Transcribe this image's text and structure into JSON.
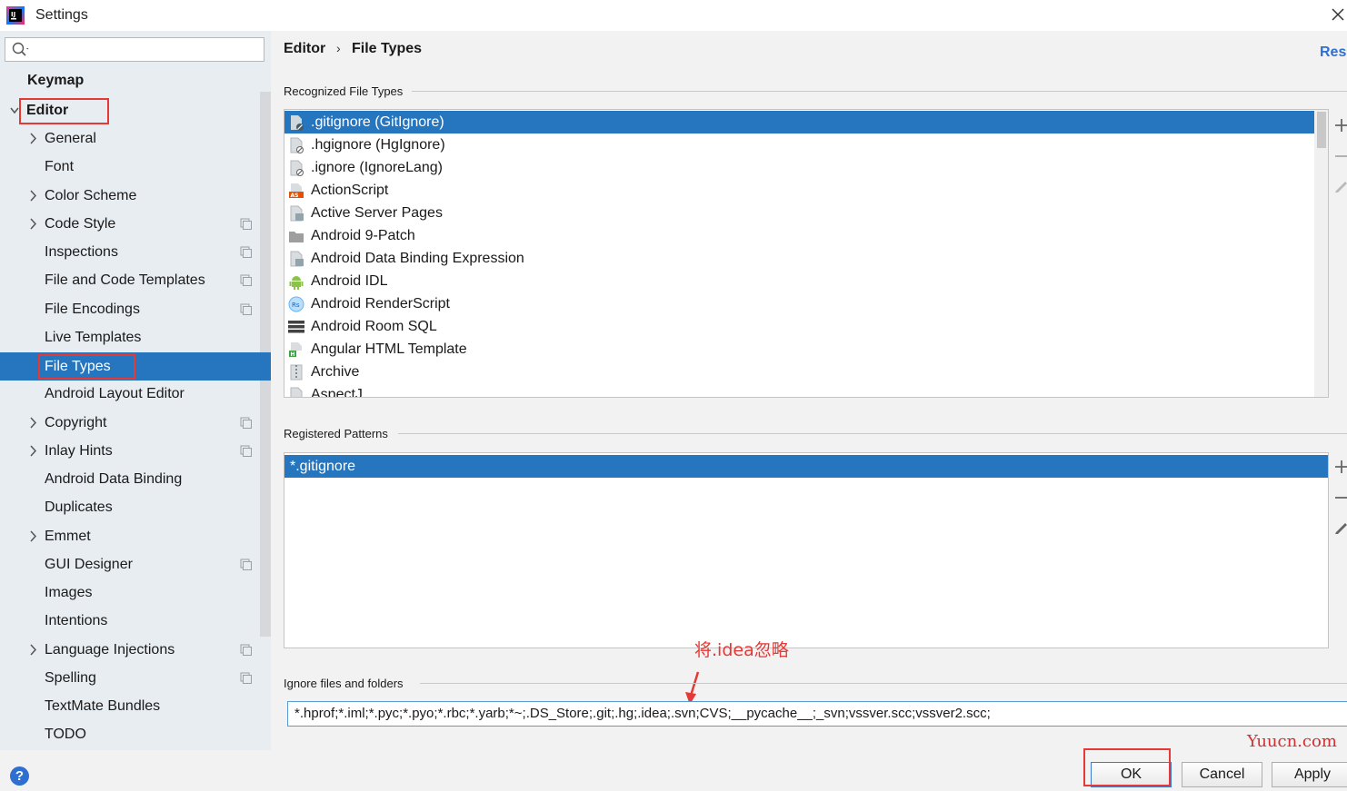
{
  "window": {
    "title": "Settings"
  },
  "search": {
    "placeholder": ""
  },
  "sidebar": {
    "items": [
      {
        "label": "Keymap",
        "name": "keymap"
      },
      {
        "label": "Editor",
        "name": "editor"
      },
      {
        "label": "General",
        "name": "general"
      },
      {
        "label": "Font",
        "name": "font"
      },
      {
        "label": "Color Scheme",
        "name": "color-scheme"
      },
      {
        "label": "Code Style",
        "name": "code-style"
      },
      {
        "label": "Inspections",
        "name": "inspections"
      },
      {
        "label": "File and Code Templates",
        "name": "file-and-code-templates"
      },
      {
        "label": "File Encodings",
        "name": "file-encodings"
      },
      {
        "label": "Live Templates",
        "name": "live-templates"
      },
      {
        "label": "File Types",
        "name": "file-types"
      },
      {
        "label": "Android Layout Editor",
        "name": "android-layout-editor"
      },
      {
        "label": "Copyright",
        "name": "copyright"
      },
      {
        "label": "Inlay Hints",
        "name": "inlay-hints"
      },
      {
        "label": "Android Data Binding",
        "name": "android-data-binding"
      },
      {
        "label": "Duplicates",
        "name": "duplicates"
      },
      {
        "label": "Emmet",
        "name": "emmet"
      },
      {
        "label": "GUI Designer",
        "name": "gui-designer"
      },
      {
        "label": "Images",
        "name": "images"
      },
      {
        "label": "Intentions",
        "name": "intentions"
      },
      {
        "label": "Language Injections",
        "name": "language-injections"
      },
      {
        "label": "Spelling",
        "name": "spelling"
      },
      {
        "label": "TextMate Bundles",
        "name": "textmate-bundles"
      },
      {
        "label": "TODO",
        "name": "todo"
      }
    ]
  },
  "header": {
    "breadcrumb_parent": "Editor",
    "breadcrumb_sep": "›",
    "breadcrumb_current": "File Types",
    "reset_label": "Rese"
  },
  "recognized": {
    "title": "Recognized File Types",
    "items": [
      {
        "label": ".gitignore (GitIgnore)",
        "icon": "gitignore-file-icon"
      },
      {
        "label": ".hgignore (HgIgnore)",
        "icon": "ignore-file-icon"
      },
      {
        "label": ".ignore (IgnoreLang)",
        "icon": "ignore-file-icon"
      },
      {
        "label": "ActionScript",
        "icon": "actionscript-icon"
      },
      {
        "label": "Active Server Pages",
        "icon": "asp-file-icon"
      },
      {
        "label": "Android 9-Patch",
        "icon": "folder-icon"
      },
      {
        "label": "Android Data Binding Expression",
        "icon": "binding-file-icon"
      },
      {
        "label": "Android IDL",
        "icon": "android-icon"
      },
      {
        "label": "Android RenderScript",
        "icon": "renderscript-icon"
      },
      {
        "label": "Android Room SQL",
        "icon": "sql-icon"
      },
      {
        "label": "Angular HTML Template",
        "icon": "html-file-icon"
      },
      {
        "label": "Archive",
        "icon": "archive-icon"
      },
      {
        "label": "AspectJ",
        "icon": "aspectj-icon"
      }
    ]
  },
  "patterns": {
    "title": "Registered Patterns",
    "items": [
      {
        "label": "*.gitignore"
      }
    ]
  },
  "ignore": {
    "title": "Ignore files and folders",
    "value": "*.hprof;*.iml;*.pyc;*.pyo;*.rbc;*.yarb;*~;.DS_Store;.git;.hg;.idea;.svn;CVS;__pycache__;_svn;vssver.scc;vssver2.scc;"
  },
  "annotation": {
    "text": "将.idea忽略"
  },
  "watermark": {
    "text": "Yuucn.com"
  },
  "buttons": {
    "ok": "OK",
    "cancel": "Cancel",
    "apply": "Apply"
  },
  "help": {
    "label": "?"
  },
  "colors": {
    "selection": "#2675bf",
    "annotation": "#e53935",
    "link": "#2f6fd1"
  }
}
